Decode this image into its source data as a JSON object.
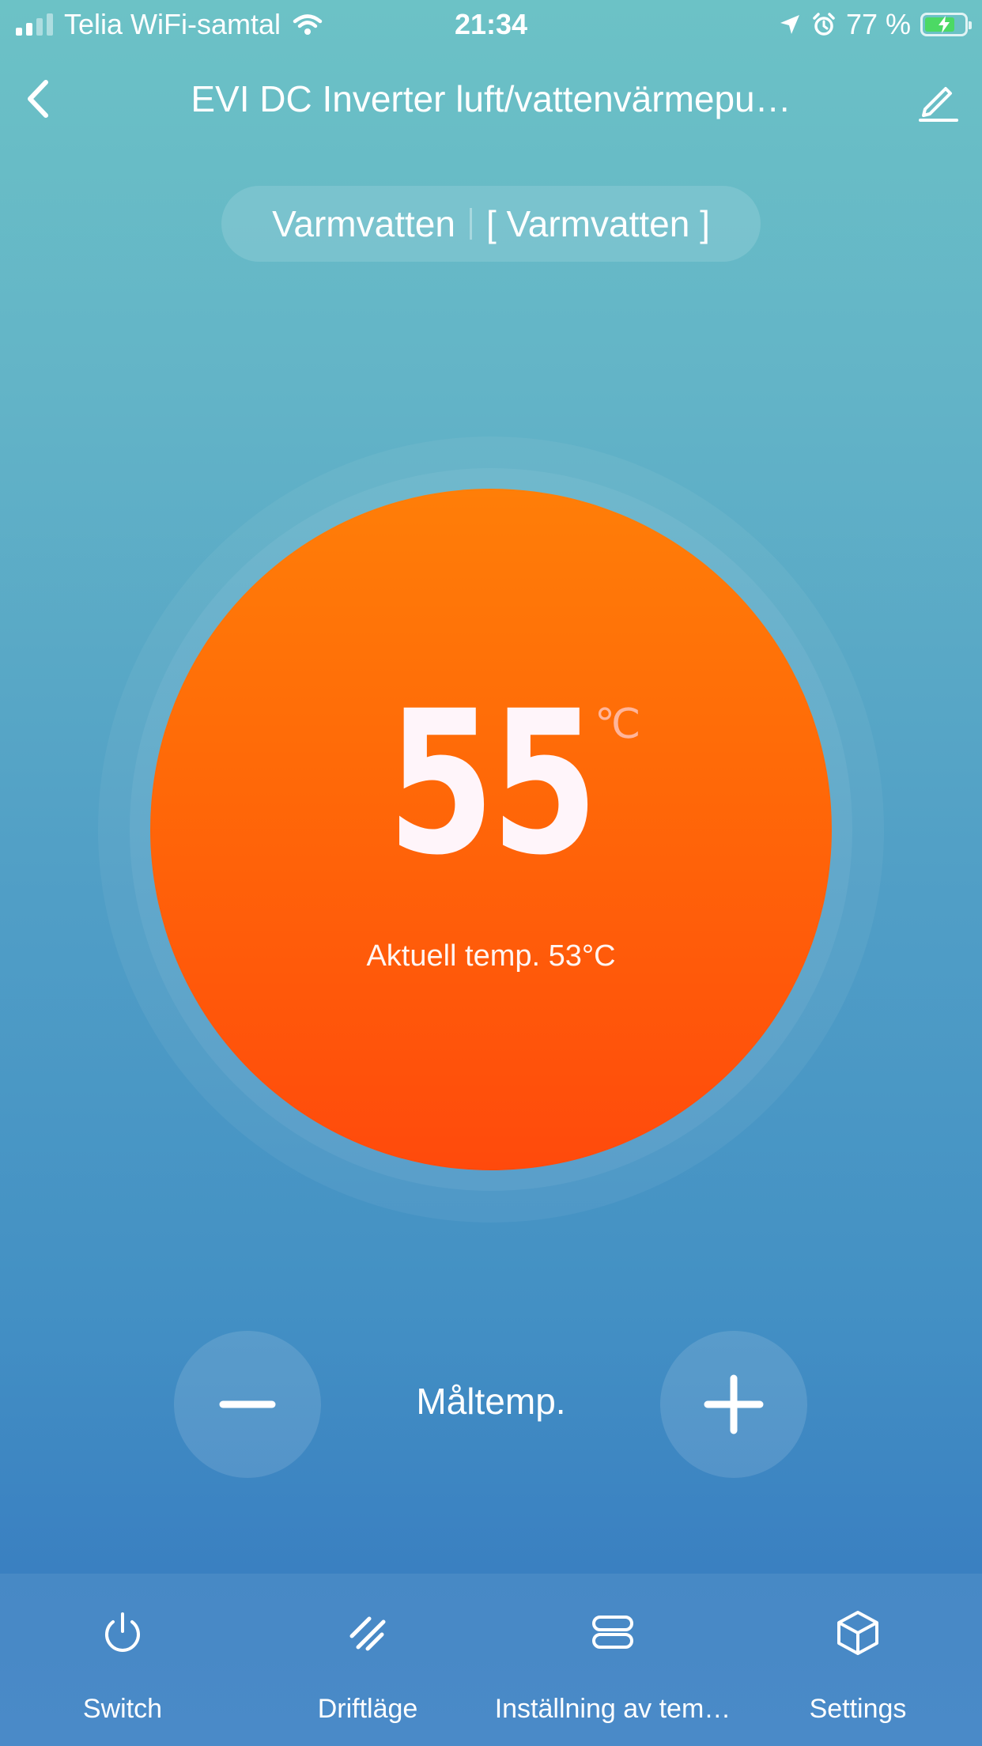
{
  "status_bar": {
    "carrier": "Telia WiFi-samtal",
    "time": "21:34",
    "battery_percent": "77 %",
    "battery_level": 0.77
  },
  "nav": {
    "title": "EVI DC Inverter luft/vattenvärmepu…"
  },
  "mode": {
    "primary": "Varmvatten",
    "secondary": "[ Varmvatten ]"
  },
  "dial": {
    "target_value": "55",
    "unit": "℃",
    "current_temp": "Aktuell temp. 53°C"
  },
  "controls": {
    "label": "Måltemp."
  },
  "tabs": [
    {
      "label": "Switch",
      "icon": "power-icon"
    },
    {
      "label": "Driftläge",
      "icon": "mode-slashes-icon"
    },
    {
      "label": "Inställning av tem…",
      "icon": "stack-icon"
    },
    {
      "label": "Settings",
      "icon": "cube-icon"
    }
  ],
  "colors": {
    "dial_top": "#ff7e08",
    "dial_bottom": "#ff4a0c",
    "bg_top": "#6cc2c6",
    "bg_bottom": "#3a80c1",
    "unit": "#ffb59a"
  }
}
